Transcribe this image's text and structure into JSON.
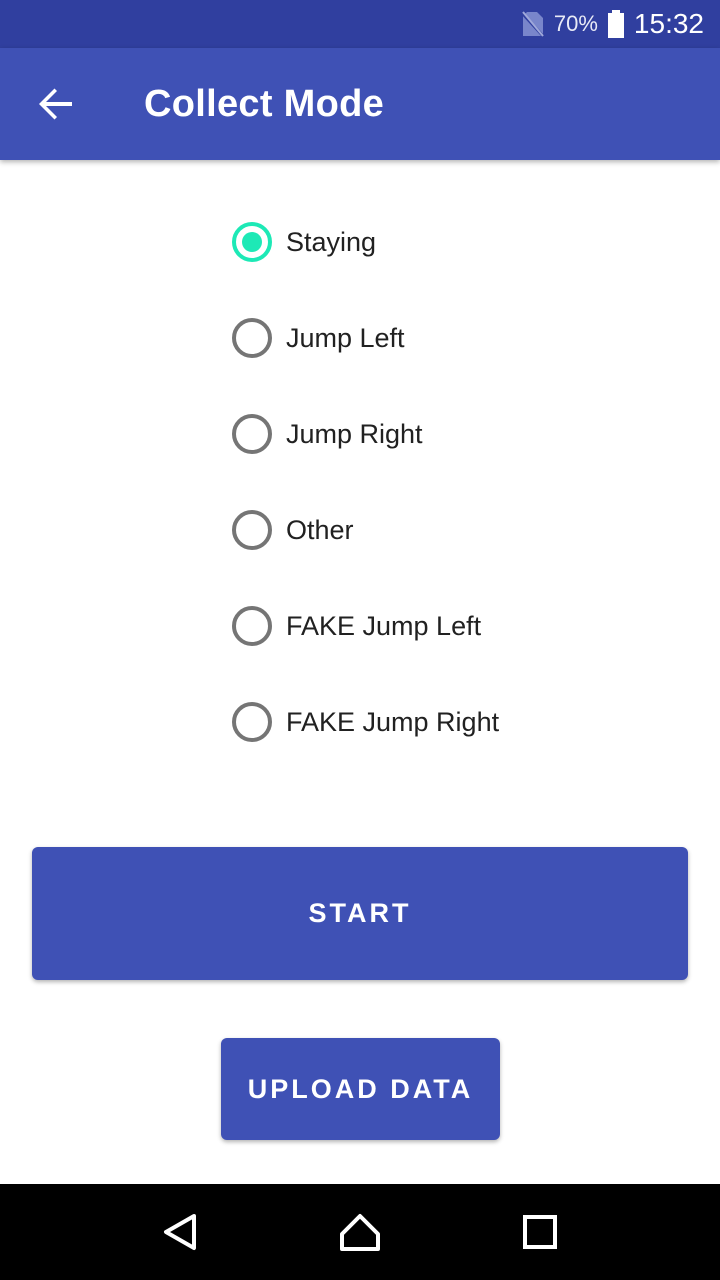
{
  "status_bar": {
    "battery_percent": "70%",
    "time": "15:32",
    "icons": [
      "no-sim-icon",
      "battery-icon"
    ]
  },
  "app_bar": {
    "title": "Collect Mode",
    "back_icon": "arrow-back-icon"
  },
  "radio_group": {
    "selected": "Staying",
    "options": [
      {
        "label": "Staying",
        "checked": true
      },
      {
        "label": "Jump Left",
        "checked": false
      },
      {
        "label": "Jump Right",
        "checked": false
      },
      {
        "label": "Other",
        "checked": false
      },
      {
        "label": "FAKE Jump Left",
        "checked": false
      },
      {
        "label": "FAKE Jump Right",
        "checked": false
      }
    ],
    "accent_color": "#1DE9B6"
  },
  "buttons": {
    "start_label": "START",
    "upload_label": "UPLOAD DATA"
  },
  "nav_bar": {
    "icons": [
      "back-triangle-icon",
      "home-icon",
      "recents-square-icon"
    ]
  },
  "colors": {
    "primary": "#3F51B5",
    "primary_dark": "#303F9F",
    "accent": "#1DE9B6"
  }
}
